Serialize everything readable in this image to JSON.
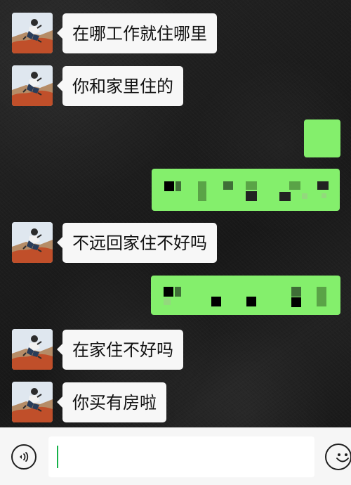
{
  "chat": {
    "incoming": [
      {
        "text": "在哪工作就住哪里"
      },
      {
        "text": "你和家里住的"
      },
      {
        "text": "不远回家住不好吗"
      },
      {
        "text": "在家住不好吗"
      },
      {
        "text": "你买有房啦"
      }
    ]
  },
  "composer": {
    "value": "",
    "placeholder": ""
  },
  "icons": {
    "voice": "voice-icon",
    "emoji": "emoji-icon",
    "avatar": "avatar-icon"
  },
  "colors": {
    "incoming_bubble": "#f7f7f7",
    "outgoing_bubble": "#84ef6c",
    "composer_cursor": "#17b24a",
    "background": "#1d1d1d"
  }
}
